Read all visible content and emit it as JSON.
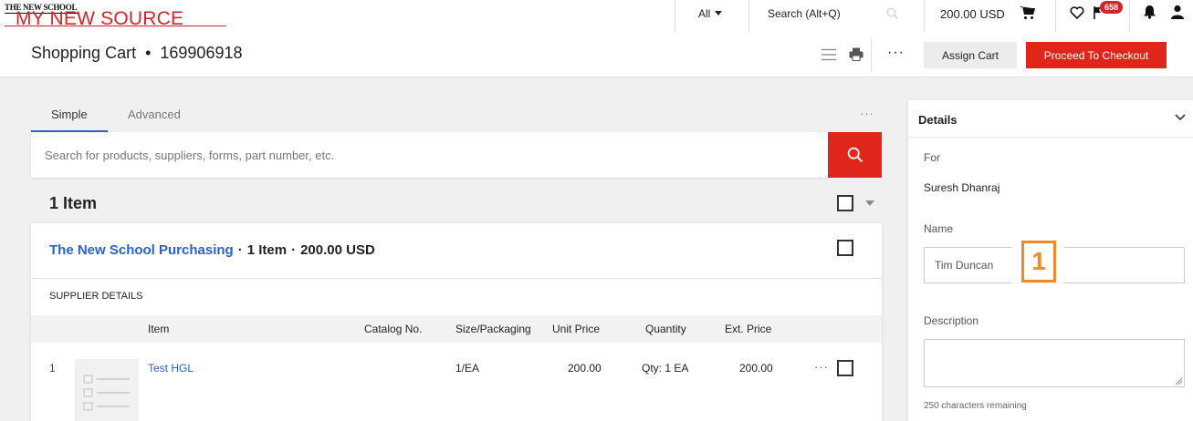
{
  "logo": {
    "top_text": "THE NEW SCHOOL",
    "main_text": "MY NEW SOURCE"
  },
  "topbar": {
    "search_scope": "All",
    "search_placeholder": "Search (Alt+Q)",
    "cart_total": "200.00 USD",
    "notification_count": "658",
    "icons": [
      "search-icon",
      "cart-icon",
      "heart-icon",
      "flag-icon",
      "bell-icon",
      "user-icon"
    ]
  },
  "header": {
    "title": "Shopping Cart",
    "separator": "•",
    "cart_number": "169906918",
    "more_label": "···",
    "assign_label": "Assign Cart",
    "checkout_label": "Proceed To Checkout"
  },
  "tabs": {
    "simple": "Simple",
    "advanced": "Advanced",
    "more": "···"
  },
  "search": {
    "placeholder": "Search for products, suppliers, forms, part number, etc."
  },
  "cart": {
    "item_count": "1 Item",
    "supplier": {
      "name": "The New School Purchasing",
      "sep": "·",
      "items": "1 Item",
      "total": "200.00 USD",
      "details_label": "SUPPLIER DETAILS"
    },
    "columns": {
      "item": "Item",
      "catalog": "Catalog No.",
      "size": "Size/Packaging",
      "unit_price": "Unit Price",
      "quantity": "Quantity",
      "ext_price": "Ext. Price"
    },
    "rows": [
      {
        "num": "1",
        "item": "Test HGL",
        "catalog": "",
        "size": "1/EA",
        "unit_price": "200.00",
        "quantity": "Qty: 1 EA",
        "ext_price": "200.00",
        "more": "···"
      }
    ]
  },
  "details": {
    "heading": "Details",
    "for_label": "For",
    "for_value": "Suresh Dhanraj",
    "name_label": "Name",
    "name_value": "Tim Duncan",
    "marker": "1",
    "description_label": "Description",
    "description_value": "",
    "remaining": "250 characters remaining"
  },
  "colors": {
    "accent": "#e0251b",
    "link": "#2b62c8",
    "brand": "#d8232a",
    "marker": "#f08a24"
  }
}
